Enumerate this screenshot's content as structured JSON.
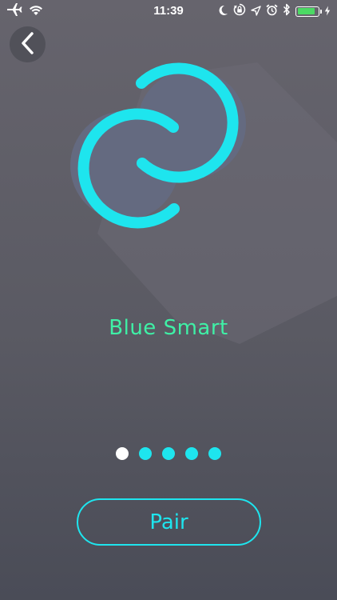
{
  "status_bar": {
    "time": "11:39",
    "battery_level": 0.85,
    "battery_color": "#4cd964",
    "icons": [
      "airplane-icon",
      "wifi-icon",
      "moon-icon",
      "orientation-lock-icon",
      "location-arrow-icon",
      "alarm-icon",
      "bluetooth-icon",
      "battery-icon",
      "charging-bolt-icon"
    ]
  },
  "nav": {
    "back_icon": "chevron-left-icon"
  },
  "logo": {
    "icon": "linked-circles-icon",
    "accent_color": "#1ee5ee"
  },
  "onboarding": {
    "app_name": "Blue Smart",
    "app_name_color": "#3ff0a6",
    "page_count": 5,
    "current_page": 1
  },
  "actions": {
    "pair_label": "Pair"
  }
}
